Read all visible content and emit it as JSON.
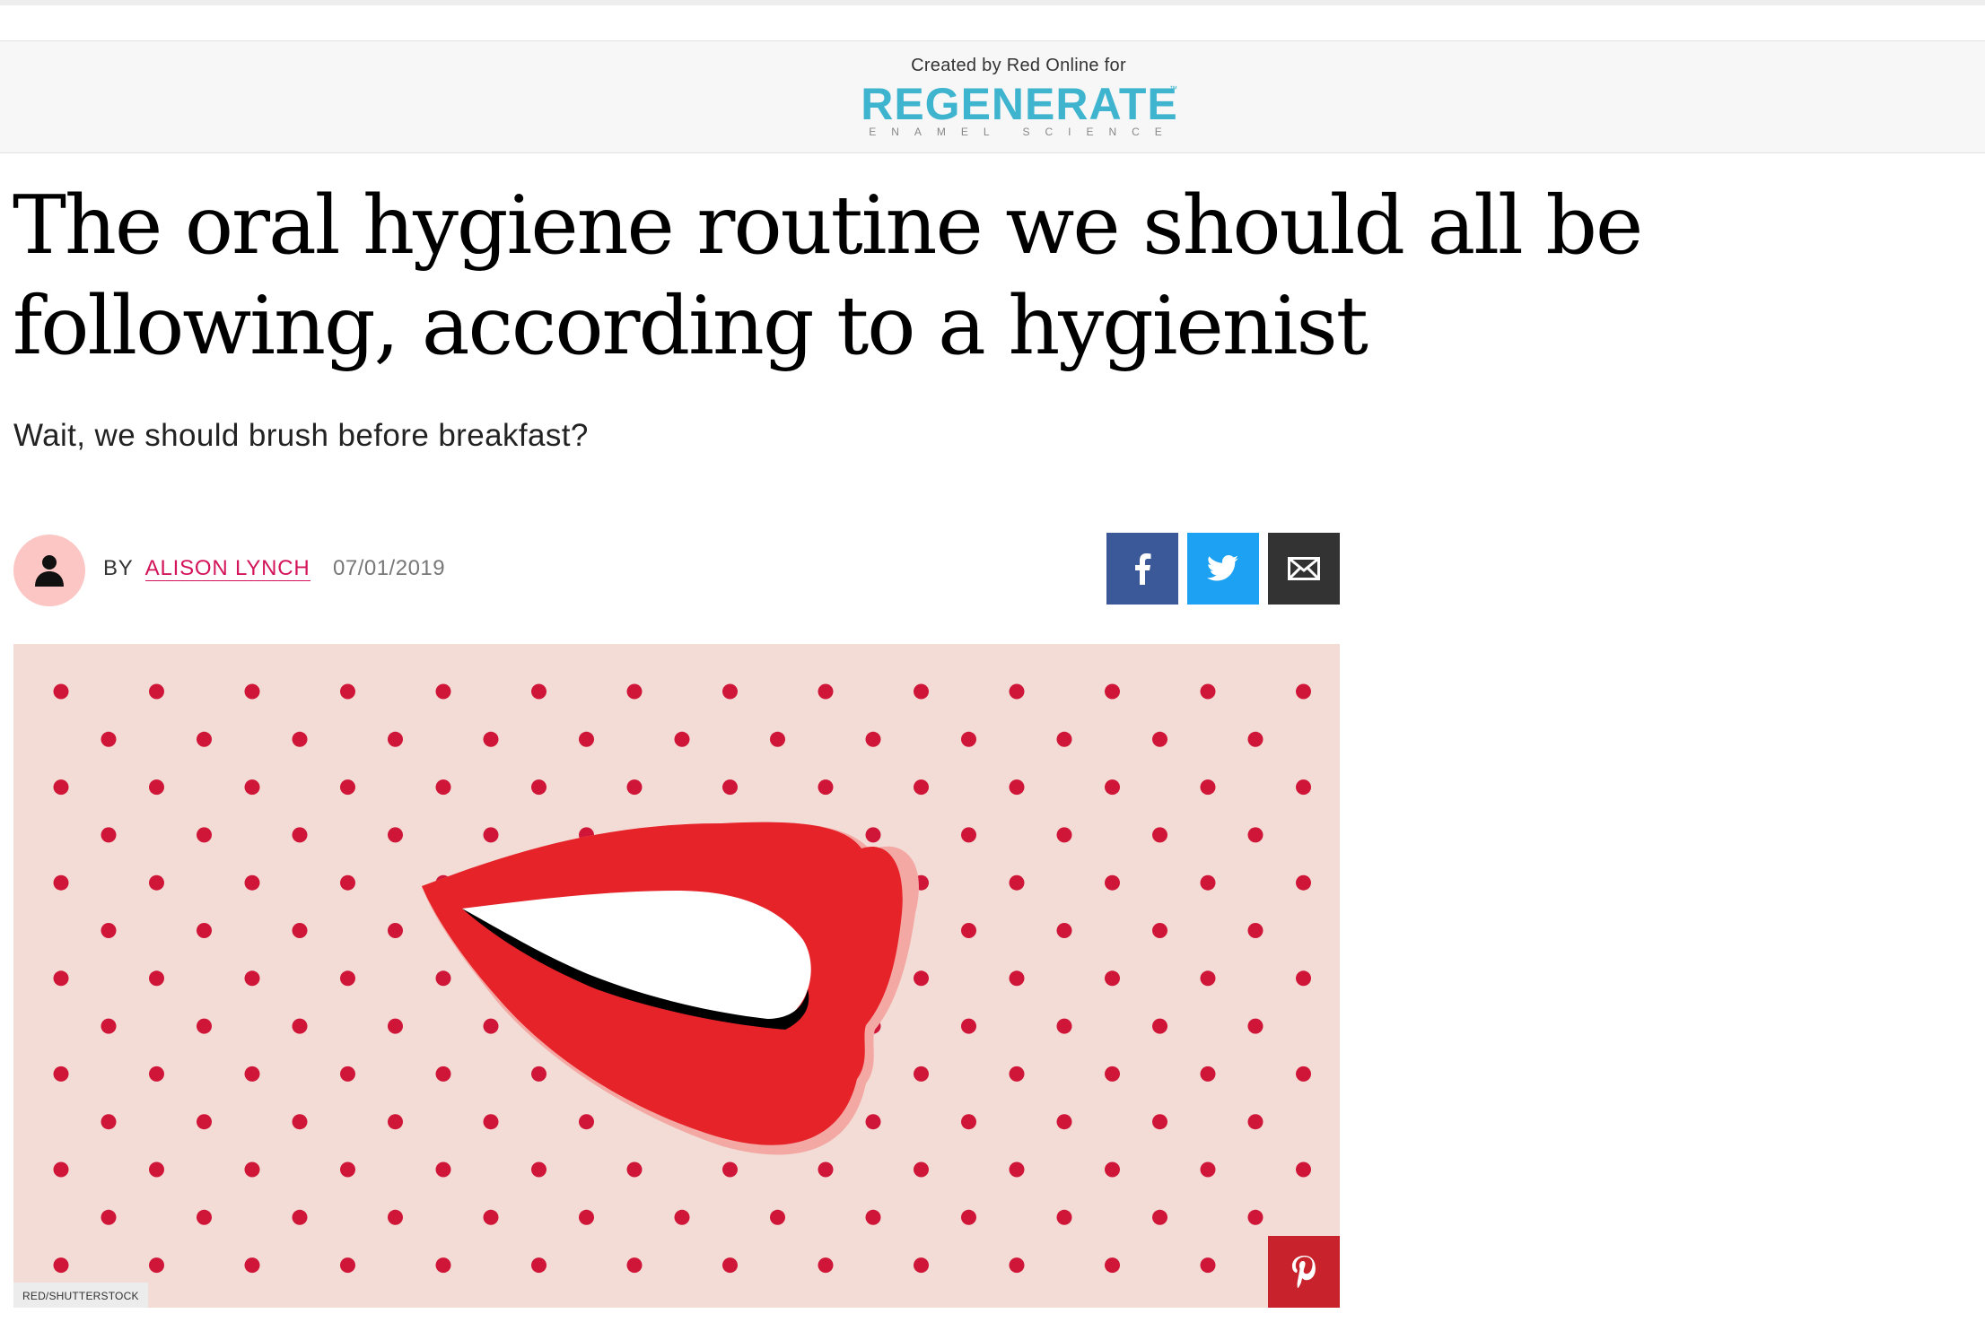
{
  "sponsor": {
    "created_by": "Created by Red Online for",
    "logo_word": "REGENERATE",
    "logo_tm": "™",
    "logo_sub": "ENAMEL SCIENCE",
    "logo_color": "#3fb4cf"
  },
  "article": {
    "headline": "The oral hygiene routine we should all be following, according to a hygienist",
    "dek": "Wait, we should brush before breakfast?",
    "byline_prefix": "BY",
    "author": "ALISON LYNCH",
    "date": "07/01/2019",
    "author_color": "#d4145a"
  },
  "share": {
    "facebook_icon": "facebook-icon",
    "twitter_icon": "twitter-icon",
    "email_icon": "email-icon",
    "colors": {
      "facebook": "#3b5998",
      "twitter": "#1da1f2",
      "email": "#333333"
    }
  },
  "hero": {
    "image": "red lips on pink polka-dot background",
    "credit": "RED/SHUTTERSTOCK",
    "pin_icon": "pinterest-icon",
    "background": "#f2dcd5",
    "dot_color": "#d01638",
    "lip_color": "#e52329"
  }
}
